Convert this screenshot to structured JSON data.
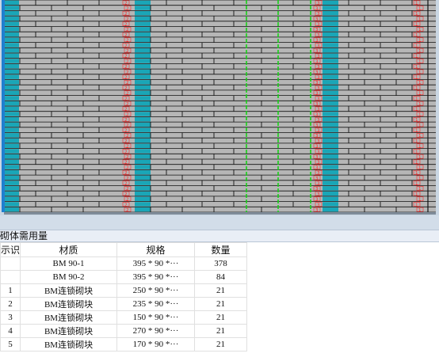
{
  "wall": {
    "bg_color": "#c9d6e3",
    "brick_color": "#b6b6b6",
    "special_brick_color": "#1aa6b7",
    "mortar_color": "#111111",
    "marker_color": "#ff2a2a",
    "green_line_color": "#18d018",
    "frame_color": "#1e7fd0",
    "markers": {
      "row_a": [
        "2",
        "3",
        "1"
      ],
      "row_b": [
        "2",
        "3",
        "1"
      ]
    }
  },
  "table": {
    "title": "砌体需用量",
    "columns": [
      "示识",
      "材质",
      "规格",
      "数量"
    ],
    "rows": [
      {
        "id": "",
        "material": "BM 90-1",
        "spec": "395 * 90 *···",
        "qty": "378"
      },
      {
        "id": "",
        "material": "BM 90-2",
        "spec": "395 * 90 *···",
        "qty": "84"
      },
      {
        "id": "1",
        "material": "BM连锁砌块",
        "spec": "250 * 90 *···",
        "qty": "21"
      },
      {
        "id": "2",
        "material": "BM连锁砌块",
        "spec": "235 * 90 *···",
        "qty": "21"
      },
      {
        "id": "3",
        "material": "BM连锁砌块",
        "spec": "150 * 90 *···",
        "qty": "21"
      },
      {
        "id": "4",
        "material": "BM连锁砌块",
        "spec": "270 * 90 *···",
        "qty": "21"
      },
      {
        "id": "5",
        "material": "BM连锁砌块",
        "spec": "170 * 90 *···",
        "qty": "21"
      }
    ]
  }
}
